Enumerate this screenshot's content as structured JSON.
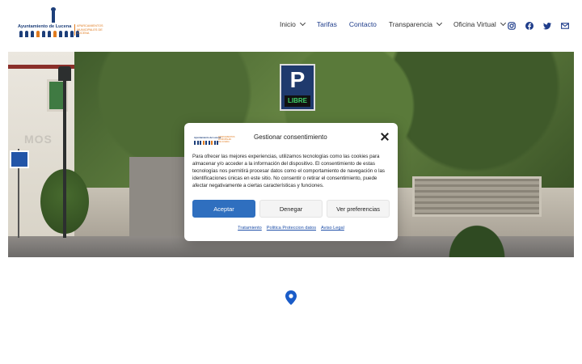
{
  "header": {
    "logo_title": "Ayuntamiento de Lucena",
    "logo_subtitle": "APARCAMIENTOS MUNICIPALES DE LUCENA",
    "nav": [
      {
        "label": "Inicio",
        "has_dropdown": true,
        "active": false
      },
      {
        "label": "Tarifas",
        "has_dropdown": false,
        "active": true
      },
      {
        "label": "Contacto",
        "has_dropdown": false,
        "active": true
      },
      {
        "label": "Transparencia",
        "has_dropdown": true,
        "active": false
      },
      {
        "label": "Oficina Virtual",
        "has_dropdown": true,
        "active": false
      }
    ],
    "social_icons": [
      "instagram-icon",
      "facebook-icon",
      "twitter-icon",
      "mail-icon"
    ]
  },
  "hero": {
    "parking_sign": "P",
    "parking_status": "LIBRE",
    "wall_text": "MOS"
  },
  "consent": {
    "title": "Gestionar consentimiento",
    "body": "Para ofrecer las mejores experiencias, utilizamos tecnologías como las cookies para almacenar y/o acceder a la información del dispositivo. El consentimiento de estas tecnologías nos permitirá procesar datos como el comportamiento de navegación o las identificaciones únicas en este sitio. No consentir o retirar el consentimiento, puede afectar negativamente a ciertas características y funciones.",
    "accept": "Aceptar",
    "deny": "Denegar",
    "preferences": "Ver preferencias",
    "links": [
      "Tratamiento",
      "Politica Proteccion datos",
      "Aviso Legal"
    ]
  },
  "colors": {
    "accent": "#2f6fbf",
    "nav_active": "#1f3d8b",
    "pin": "#1a5cc8"
  }
}
